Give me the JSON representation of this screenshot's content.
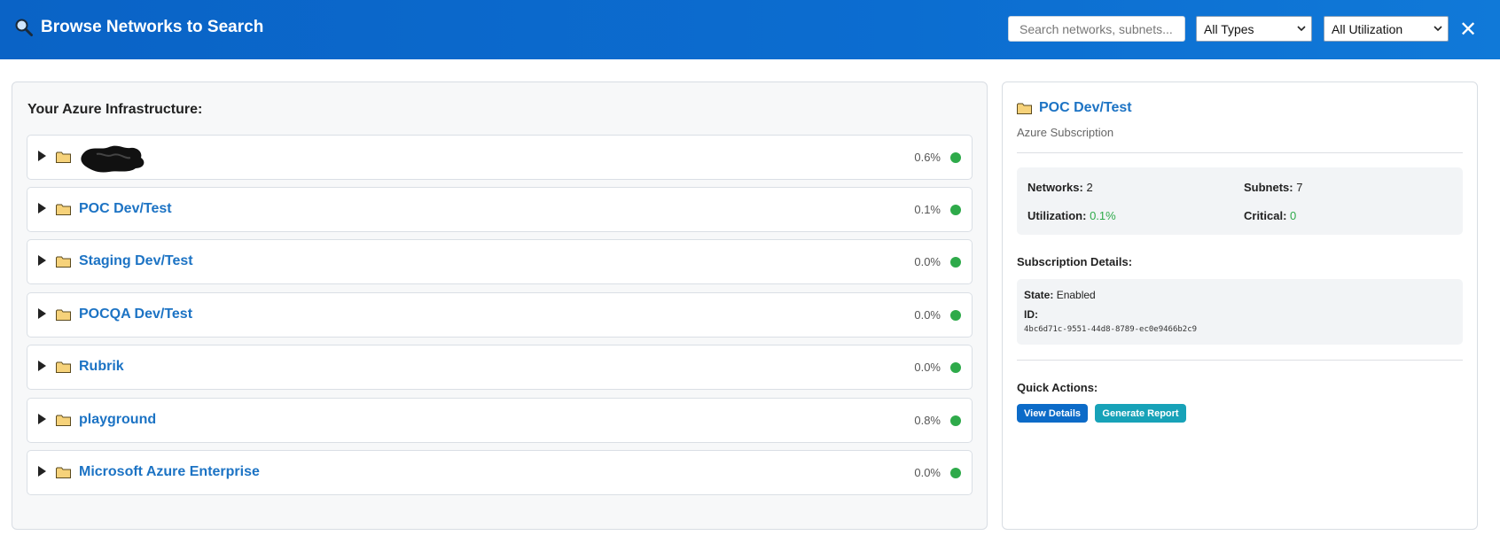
{
  "header": {
    "title": "Browse Networks to Search",
    "search_placeholder": "Search networks, subnets...",
    "type_filter": "All Types",
    "util_filter": "All Utilization",
    "close_symbol": "✕"
  },
  "left": {
    "heading": "Your Azure Infrastructure:",
    "items": [
      {
        "label": "",
        "redacted": true,
        "utilization": "0.6%",
        "status_color": "#2eaa4a"
      },
      {
        "label": "POC Dev/Test",
        "utilization": "0.1%",
        "status_color": "#2eaa4a"
      },
      {
        "label": "Staging Dev/Test",
        "utilization": "0.0%",
        "status_color": "#2eaa4a"
      },
      {
        "label": "POCQA Dev/Test",
        "utilization": "0.0%",
        "status_color": "#2eaa4a"
      },
      {
        "label": "Rubrik",
        "utilization": "0.0%",
        "status_color": "#2eaa4a"
      },
      {
        "label": "playground",
        "utilization": "0.8%",
        "status_color": "#2eaa4a"
      },
      {
        "label": "Microsoft Azure Enterprise",
        "utilization": "0.0%",
        "status_color": "#2eaa4a"
      }
    ]
  },
  "details": {
    "title": "POC Dev/Test",
    "subtitle": "Azure Subscription",
    "stats": {
      "networks_label": "Networks:",
      "networks_value": "2",
      "subnets_label": "Subnets:",
      "subnets_value": "7",
      "utilization_label": "Utilization:",
      "utilization_value": "0.1%",
      "critical_label": "Critical:",
      "critical_value": "0"
    },
    "subscription_heading": "Subscription Details:",
    "state_label": "State:",
    "state_value": "Enabled",
    "id_label": "ID:",
    "id_value": "4bc6d71c-9551-44d8-8789-ec0e9466b2c9",
    "quick_actions_heading": "Quick Actions:",
    "view_details_label": "View Details",
    "generate_report_label": "Generate Report"
  },
  "colors": {
    "accent": "#0c6dd0",
    "link": "#1c73c4",
    "status_ok": "#2eaa4a",
    "report_button": "#17a2b8"
  }
}
